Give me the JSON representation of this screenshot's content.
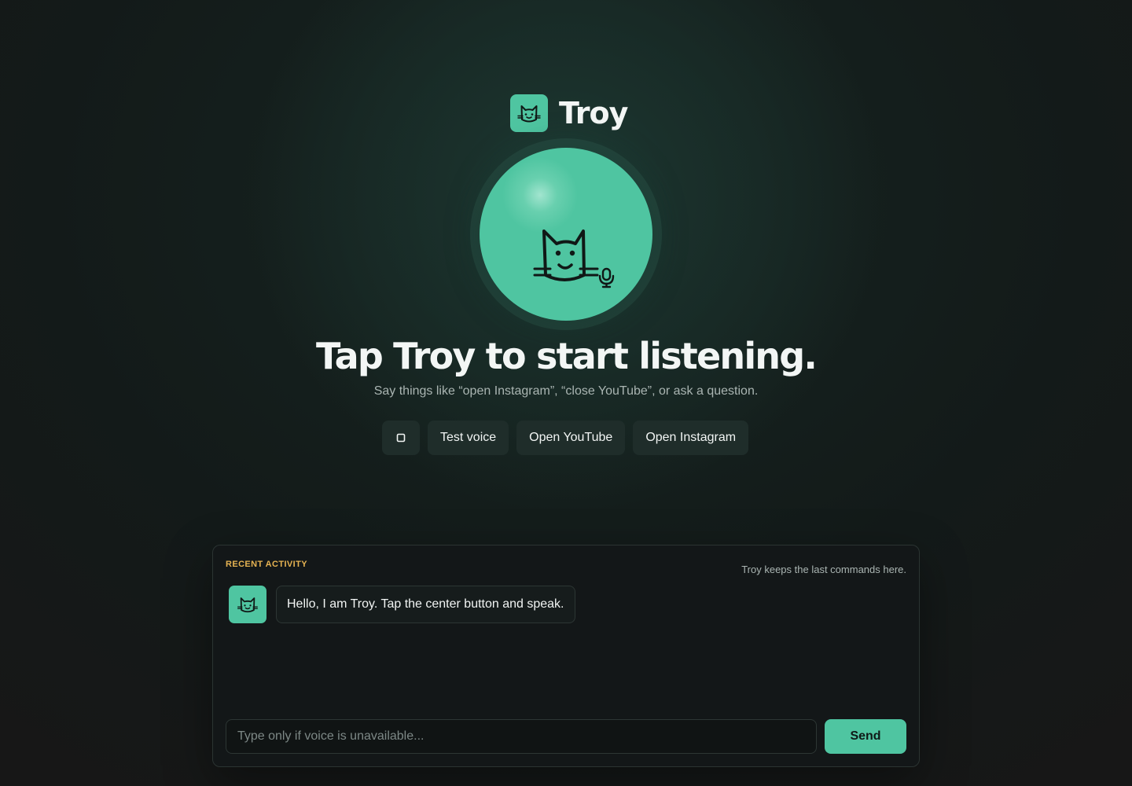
{
  "app": {
    "name": "Troy",
    "logo_icon": "cat-icon"
  },
  "hero": {
    "orb_icon": "cat-face-icon",
    "mic_icon": "microphone-icon",
    "headline": "Tap Troy to start listening.",
    "subline": "Say things like “open Instagram”, “close YouTube”, or ask a question."
  },
  "actions": {
    "stop_icon": "stop-icon",
    "test_voice": "Test voice",
    "open_youtube": "Open YouTube",
    "open_instagram": "Open Instagram"
  },
  "activity": {
    "label": "RECENT ACTIVITY",
    "note": "Troy keeps the last commands here.",
    "messages": [
      {
        "sender": "Troy",
        "avatar_icon": "cat-icon",
        "text": "Hello, I am Troy. Tap the center button and speak."
      }
    ]
  },
  "composer": {
    "placeholder": "Type only if voice is unavailable...",
    "value": "",
    "send_label": "Send"
  },
  "colors": {
    "accent": "#4fc5a1",
    "label": "#e6b352",
    "background": "#131a19"
  }
}
